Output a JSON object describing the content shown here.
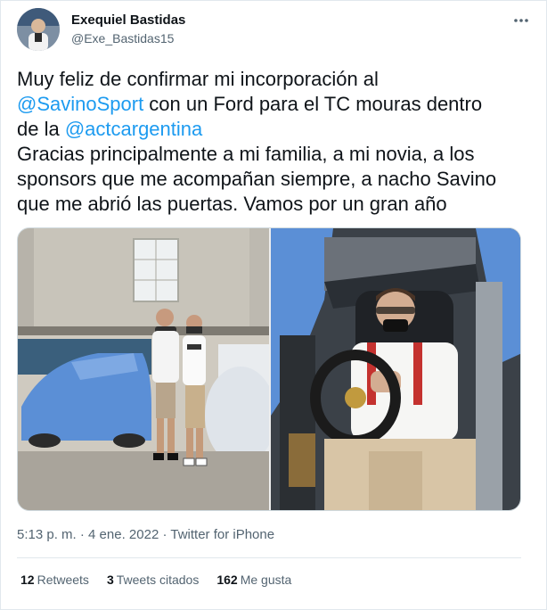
{
  "author": {
    "name": "Exequiel Bastidas",
    "handle": "@Exe_Bastidas15"
  },
  "tweet": {
    "line1": "Muy feliz de confirmar mi incorporación al",
    "mention1": "@SavinoSport",
    "line2_rest": " con un Ford para el TC mouras dentro",
    "line3_start": "de la ",
    "mention2": "@actcargentina",
    "line4": "Gracias principalmente a mi familia, a mi novia, a los",
    "line5": "sponsors que me acompañan siempre, a nacho Savino",
    "line6": "que me abrió las puertas. Vamos por un gran año"
  },
  "meta": {
    "time": "5:13 p. m.",
    "separator1": " · ",
    "date": "4 ene. 2022",
    "separator2": " · ",
    "source": "Twitter for iPhone"
  },
  "stats": {
    "retweets_count": "12",
    "retweets_label": "Retweets",
    "quotes_count": "3",
    "quotes_label": "Tweets citados",
    "likes_count": "162",
    "likes_label": "Me gusta"
  },
  "icons": {
    "more": "more-horizontal-icon"
  },
  "colors": {
    "link": "#1d9bf0",
    "secondary_text": "#536471",
    "primary_text": "#0f1419",
    "car_blue": "#5b8fd6"
  }
}
